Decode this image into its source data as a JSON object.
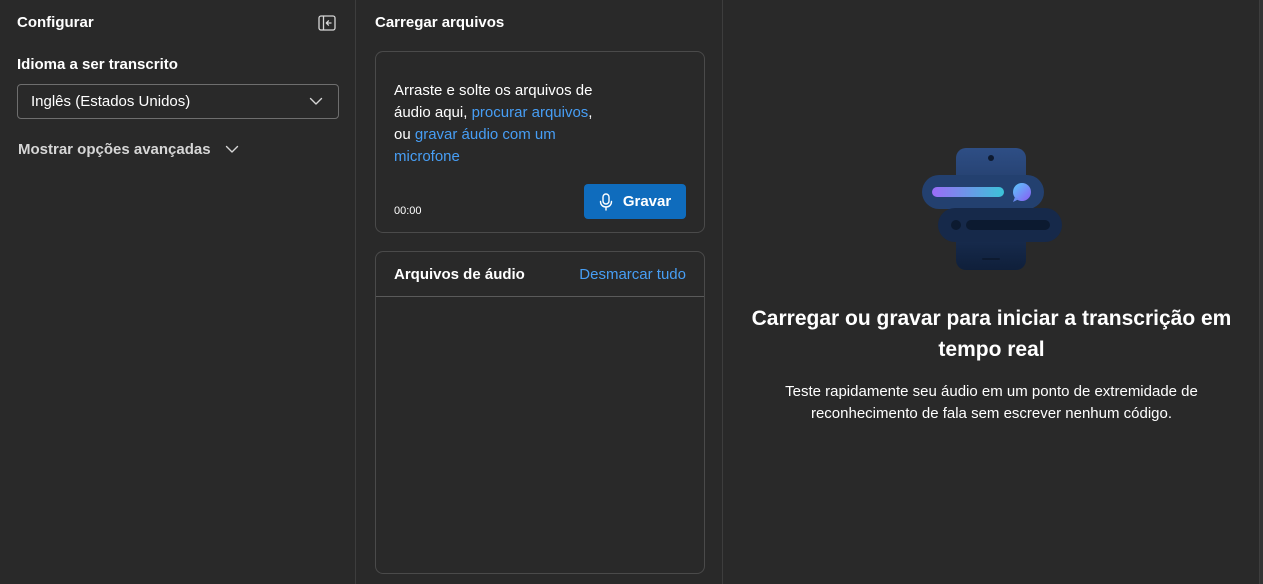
{
  "config": {
    "title": "Configurar",
    "language_label": "Idioma a ser transcrito",
    "language_value": "Inglês (Estados Unidos)",
    "advanced_label": "Mostrar opções avançadas"
  },
  "upload": {
    "title": "Carregar arquivos",
    "drop_text": "Arraste e solte os arquivos de áudio aqui,",
    "browse_link": "procurar arquivos",
    "separator": ", ou",
    "record_link": "gravar áudio com um microfone",
    "timer": "00:00",
    "record_button": "Gravar"
  },
  "files": {
    "title": "Arquivos de áudio",
    "deselect_all": "Desmarcar tudo"
  },
  "empty_state": {
    "title": "Carregar ou gravar para iniciar a transcrição em tempo real",
    "description": "Teste rapidamente seu áudio em um ponto de extremidade de reconhecimento de fala sem escrever nenhum código."
  },
  "colors": {
    "background": "#292929",
    "accent": "#0f6cbd",
    "link": "#479ef5",
    "border": "#4a4a4a"
  },
  "icons": {
    "collapse": "panel-collapse-icon",
    "dropdown": "chevron-down-icon",
    "microphone": "microphone-icon",
    "illustration": "speech-transcription-illustration"
  }
}
